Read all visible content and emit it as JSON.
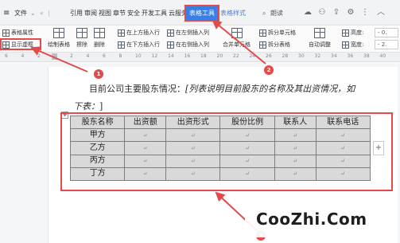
{
  "menubar": {
    "menu_icon": "≡",
    "file": "文件",
    "items": [
      "引用",
      "审阅",
      "视图",
      "章节",
      "安全",
      "开发工具",
      "云服务"
    ],
    "active_tab": "表格工具",
    "next_tab": "表格样式",
    "search": "朗读"
  },
  "ribbon": {
    "table_props": "表格属性",
    "show_gridlines": "显示虚框",
    "draw_table": "绘制表格",
    "erase": "擦除",
    "delete": "删除",
    "insert_above": "在上方插入行",
    "insert_below": "在下方插入行",
    "insert_left": "在左侧插入列",
    "insert_right": "在右侧插入列",
    "merge_cells": "合并单元格",
    "split_cells": "拆分单元格",
    "split_table": "拆分表格",
    "autofit": "自动调整",
    "height_label": "高度:",
    "width_label": "宽度:",
    "height_value": "- 0.",
    "width_value": "- 2."
  },
  "ruler": {
    "numbers": [
      "6",
      "4",
      "2",
      "",
      "2",
      "4",
      "6",
      "8",
      "10",
      "12",
      "14",
      "16",
      "18",
      "20",
      "22",
      "24",
      "26",
      "28",
      "30",
      "32",
      "34",
      "36",
      "38",
      "40"
    ]
  },
  "doc": {
    "line1": "目前公司主要股东情况：",
    "line1_italic": "[列表说明目前股东的名称及其出资情况，如",
    "line2": "下表：",
    "line2_mark": "]"
  },
  "table": {
    "headers": [
      "股东名称",
      "出资额",
      "出资形式",
      "股份比例",
      "联系人",
      "联系电话"
    ],
    "rows": [
      [
        "甲方",
        "↵",
        "↵",
        "↵",
        "↵",
        "↵"
      ],
      [
        "乙方",
        "↵",
        "↵",
        "↵",
        "↵",
        "↵"
      ],
      [
        "丙方",
        "↵",
        "↵",
        "↵",
        "↵",
        "↵"
      ],
      [
        "丁方",
        "↵",
        "↵",
        "↵",
        "↵",
        "↵"
      ]
    ]
  },
  "annotations": {
    "badge1": "1",
    "badge2": "2",
    "badge3": "3"
  },
  "watermark": "CooZhi.Com",
  "colors": {
    "accent": "#3a7fe6",
    "highlight_red": "#e34a4a",
    "table_fill": "#d9d9d9"
  }
}
